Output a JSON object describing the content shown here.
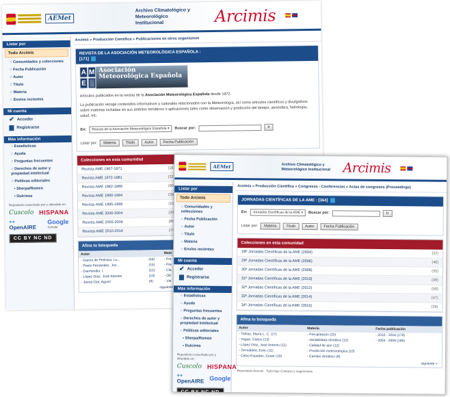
{
  "window_back": {
    "header": {
      "gov_crest": "spain-government-crest",
      "aemet": "AEMet",
      "archive_title": "Archivo Climatológico y Meteorológico Institucional",
      "brand": "Arcimis"
    },
    "breadcrumb": "Arcimis » Producción Científica » Publicaciones en otros organismos",
    "sidebar": {
      "list_head": "Listar por",
      "selected": "Todo Arcimis",
      "items": [
        "Comunidades y colecciones",
        "Fecha Publicación",
        "Autor",
        "Título",
        "Materia",
        "Envíos recientes"
      ],
      "account_head": "Mi cuenta",
      "account_items": [
        "Acceder",
        "Registrarse"
      ],
      "info_head": "Más información",
      "info_items": [
        "Estadísticas",
        "Ayuda",
        "Preguntas frecuentes",
        "Derechos de autor y propiedad intelectual",
        "Políticas editoriales"
      ],
      "info_sub": [
        "Sherpa/Romeo",
        "Dulcinea"
      ],
      "partners_note": "Repositorio cosechado por y difundido en:",
      "partners": [
        "Cuscolo",
        "HISPANA",
        "OpenAIRE",
        "Google",
        "Scholar"
      ],
      "cc": "CC BY NC ND"
    },
    "journal": {
      "title": "REVISTA DE LA ASOCIACIÓN METEOROLÓGICA ESPAÑOLA :",
      "count": "[171]",
      "logo_letters": [
        "A",
        "M",
        "E",
        "▒"
      ],
      "logo_text": "Asociación Meteorológica Española",
      "intro_pre": "Artículos publicados en la revista de la ",
      "intro_bold": "Asociación Meteorológica Española",
      "intro_post": " desde 1972.",
      "description": "La publicación recoge contenidos informativos y culturales relacionados con la Meteorología, así como artículos científicos y divulgativos sobre materias incluidas en sus ámbitos temáticos o aplicaciones tales como observación y predicción del tiempo, atmósfera, hidrología, salud, etc.",
      "search_in_label": "En:",
      "search_scope": "Revista de la Asociación Meteorológica Española",
      "search_label": "Buscar por:",
      "go_button": "Ir",
      "list_by_label": "Listar por:",
      "list_by_buttons": [
        "Materia",
        "Título",
        "Autor",
        "Fecha Publicación"
      ]
    },
    "collections": {
      "title": "Colecciones en esta comunidad",
      "rows": [
        {
          "name": "Revista AME 1967-1971",
          "count": "(16)"
        },
        {
          "name": "Revista AME 1972-1981",
          "count": "(32)"
        },
        {
          "name": "Revista AME 1982-1989",
          "count": "(90)"
        },
        {
          "name": "Revista AME 1990-1994",
          "count": "(39)"
        },
        {
          "name": "Revista AME 1995-1999",
          "count": "(10)"
        },
        {
          "name": "Revista AME 2000-2004",
          "count": "(24)"
        },
        {
          "name": "Revista AME 2005-2009",
          "count": "(86)"
        },
        {
          "name": "Revista AME 2010-2014",
          "count": "(74)"
        }
      ]
    },
    "refine": {
      "title": "Afina tu búsqueda",
      "col_author": "Autor",
      "col_subject": "Mate",
      "authors": [
        {
          "name": "García de Pedraza, Lu...",
          "count": "(44)",
          "subject": "Pre"
        },
        {
          "name": "Prieto Fernández, Jos...",
          "count": "(15)",
          "subject": "Pre"
        },
        {
          "name": "Garmendia, I.",
          "count": "(12)",
          "subject": "Cla"
        },
        {
          "name": "López Díaz, José Antonio",
          "count": "(10)",
          "subject": "Ob"
        },
        {
          "name": "Jansà Clar, Agustí",
          "count": "(8)",
          "subject": "Vie"
        }
      ],
      "next": "siguiente >"
    }
  },
  "window_front": {
    "header": {
      "aemet": "AEMet",
      "archive_title": "Archivo Climatológico y Meteorológico Institucional",
      "brand": "Arcimis"
    },
    "breadcrumb": "Arcimis » Producción Científica » Congresos - Conferencias » Actas de congresos (Proceedings)",
    "sidebar": {
      "list_head": "Listar por",
      "selected": "Todo Arcimis",
      "items": [
        "Comunidades y colecciones",
        "Fecha Publicación",
        "Autor",
        "Título",
        "Materia",
        "Envíos recientes"
      ],
      "account_head": "Mi cuenta",
      "account_items": [
        "Acceder",
        "Registrarse"
      ],
      "info_head": "Más información",
      "info_items": [
        "Estadísticas",
        "Ayuda",
        "Preguntas frecuentes",
        "Derechos de autor y propiedad intelectual",
        "Políticas editoriales"
      ],
      "info_sub": [
        "Sherpa/Romeo",
        "Dulcinea"
      ],
      "partners_note": "Repositorio cosechado por y difundido en:",
      "cc": "CC BY NC ND"
    },
    "journal": {
      "title": "JORNADAS CIENTÍFICAS DE LA AME : [364]",
      "search_in_label": "En:",
      "search_scope": "Jornadas Científicas de la AME",
      "search_label": "Buscar por:",
      "go_button": "Ir",
      "list_by_label": "Listar por:",
      "list_by_buttons": [
        "Materia",
        "Título",
        "Autor",
        "Fecha Publicación"
      ]
    },
    "collections": {
      "title": "Colecciones en esta comunidad",
      "rows": [
        {
          "name": "28ª Jornadas Científicas de la AME (2004)",
          "count": "(37)"
        },
        {
          "name": "29ª Jornadas Científicas de la AME (2006)",
          "count": "(40)"
        },
        {
          "name": "30ª Jornadas Científicas de la AME (2008)",
          "count": "(35)"
        },
        {
          "name": "31ª Jornadas Científicas de la AME (2010)",
          "count": "(49)"
        },
        {
          "name": "32ª Jornadas Científicas de la AME (2012)",
          "count": "(50)"
        },
        {
          "name": "33ª Jornadas Científicas de la AME (2014)",
          "count": "(47)"
        },
        {
          "name": "34ª Jornadas Científicas de la AME (2016)",
          "count": "(26)"
        }
      ]
    },
    "refine": {
      "title": "Afina tu búsqueda",
      "col_author": "Autor",
      "col_subject": "Materia",
      "col_date": "Fecha publicación",
      "authors": [
        "Tobías, María L. C. (17)",
        "Yagüe, Carlos (13)",
        "López Díaz, José Antonio (11)",
        "Torrealdea, Enric (11)",
        "Calvo Espadas, Cesar (10)"
      ],
      "subjects": [
        "Precipitación (22)",
        "Variabilidad climática (12)",
        "Calidad de aire (12)",
        "Predicción meteorológica (10)",
        "Cambio climático (8)"
      ],
      "dates": [
        "2010 - 2016 (178)",
        "2004 - 2009 (186)"
      ],
      "next": "siguiente >"
    },
    "footer": "Repositorio Arcimis · Todo bajo Contacto y sugerencias"
  }
}
